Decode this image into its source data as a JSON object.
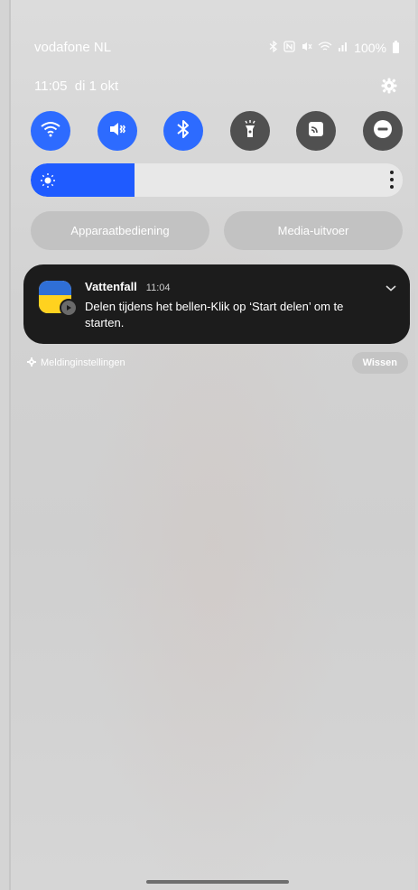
{
  "status_bar": {
    "carrier": "vodafone NL",
    "battery_level": "100%",
    "icons": [
      "bluetooth-icon",
      "nfc-icon",
      "vibrate-icon",
      "wifi-signal-icon",
      "cell-signal-icon",
      "battery-icon"
    ]
  },
  "datetime": "11:05  di 1 okt",
  "quick_toggles": [
    {
      "icon": "wifi-icon",
      "state": "on"
    },
    {
      "icon": "sound-vibrate-icon",
      "state": "on"
    },
    {
      "icon": "bluetooth-icon",
      "state": "on"
    },
    {
      "icon": "flashlight-icon",
      "state": "off"
    },
    {
      "icon": "cast-icon",
      "state": "off"
    },
    {
      "icon": "do-not-disturb-icon",
      "state": "off"
    }
  ],
  "brightness": {
    "level_percent": 28
  },
  "pills": {
    "device_control": "Apparaatbediening",
    "media_output": "Media-uitvoer"
  },
  "notification": {
    "app": "Vattenfall",
    "time": "11:04",
    "body": "Delen tijdens het bellen-Klik op ‘Start delen’ om te starten."
  },
  "footer": {
    "settings_label": "Meldinginstellingen",
    "clear_label": "Wissen"
  },
  "colors": {
    "accent_on": "#2d6bff",
    "toggle_off": "#505050",
    "notification_bg": "#1c1c1c"
  }
}
